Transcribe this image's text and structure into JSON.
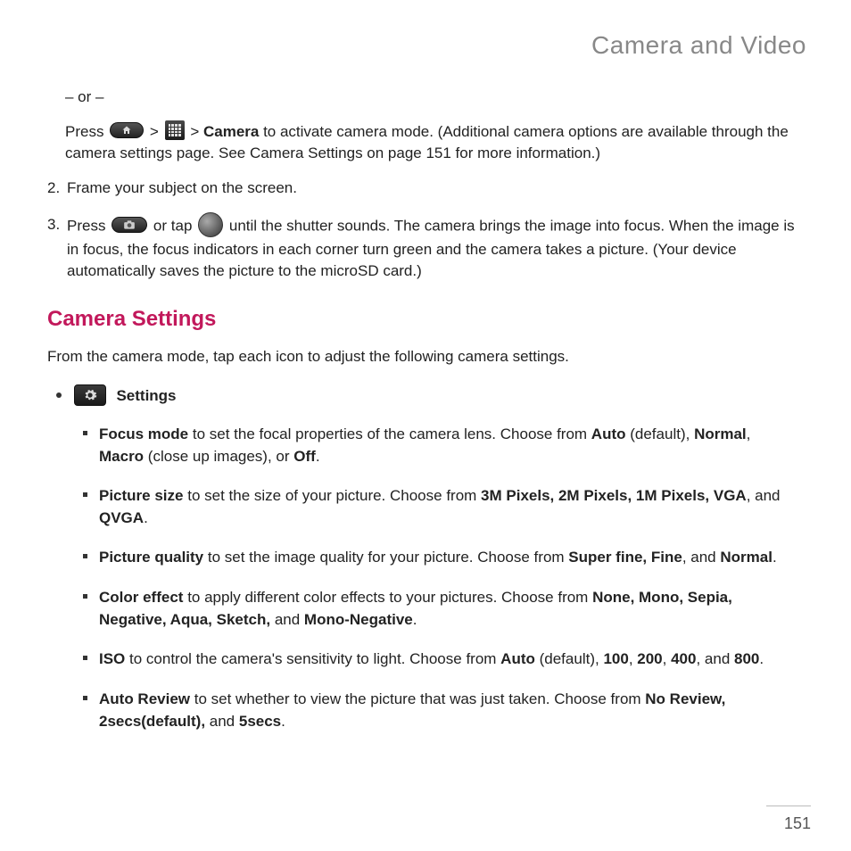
{
  "section_title": "Camera and Video",
  "or_text": "– or –",
  "press_line": {
    "p1": "Press ",
    "gt": " > ",
    "p2": " > ",
    "camera_bold": "Camera",
    "p3": " to activate camera mode. (Additional camera options are available through the camera settings page. See Camera Settings on page 151 for more information.)"
  },
  "step2": {
    "num": "2.",
    "text": "Frame your subject on the screen."
  },
  "step3": {
    "num": "3.",
    "p1": "Press ",
    "p2": " or tap ",
    "p3": " until the shutter sounds. The camera brings the image into focus. When the image is in focus, the focus indicators in each corner turn green and the camera takes a picture. (Your device automatically saves the picture to the microSD card.)"
  },
  "heading": "Camera Settings",
  "heading_desc": "From the camera mode, tap each icon to adjust the following camera settings.",
  "settings_label": "Settings",
  "items": {
    "focus": {
      "b1": "Focus mode",
      "t1": " to set the focal properties of the camera lens. Choose from ",
      "b2": "Auto",
      "t2": " (default), ",
      "b3": "Normal",
      "t3": ", ",
      "b4": "Macro",
      "t4": " (close up images), or ",
      "b5": "Off",
      "t5": "."
    },
    "size": {
      "b1": "Picture size",
      "t1": " to set the size of your picture. Choose from ",
      "b2": "3M Pixels, 2M Pixels, 1M Pixels, VGA",
      "t2": ", and ",
      "b3": "QVGA",
      "t3": "."
    },
    "quality": {
      "b1": "Picture quality",
      "t1": " to set the image quality for your picture. Choose from ",
      "b2": "Super fine, Fine",
      "t2": ", and ",
      "b3": "Normal",
      "t3": "."
    },
    "color": {
      "b1": "Color effect",
      "t1": " to apply different color effects to your pictures. Choose from ",
      "b2": "None, Mono, Sepia, Negative, Aqua, Sketch,",
      "t2": " and ",
      "b3": "Mono-Negative",
      "t3": "."
    },
    "iso": {
      "b1": "ISO",
      "t1": " to control the camera's sensitivity to light. Choose from ",
      "b2": "Auto",
      "t2": " (default), ",
      "b3": "100",
      "t3": ", ",
      "b4": "200",
      "t4": ", ",
      "b5": "400",
      "t5": ", and ",
      "b6": "800",
      "t6": "."
    },
    "review": {
      "b1": "Auto Review",
      "t1": " to set whether to view the picture that was just taken. Choose from ",
      "b2": "No Review, 2secs(default),",
      "t2": " and ",
      "b3": "5secs",
      "t3": "."
    }
  },
  "page_number": "151"
}
